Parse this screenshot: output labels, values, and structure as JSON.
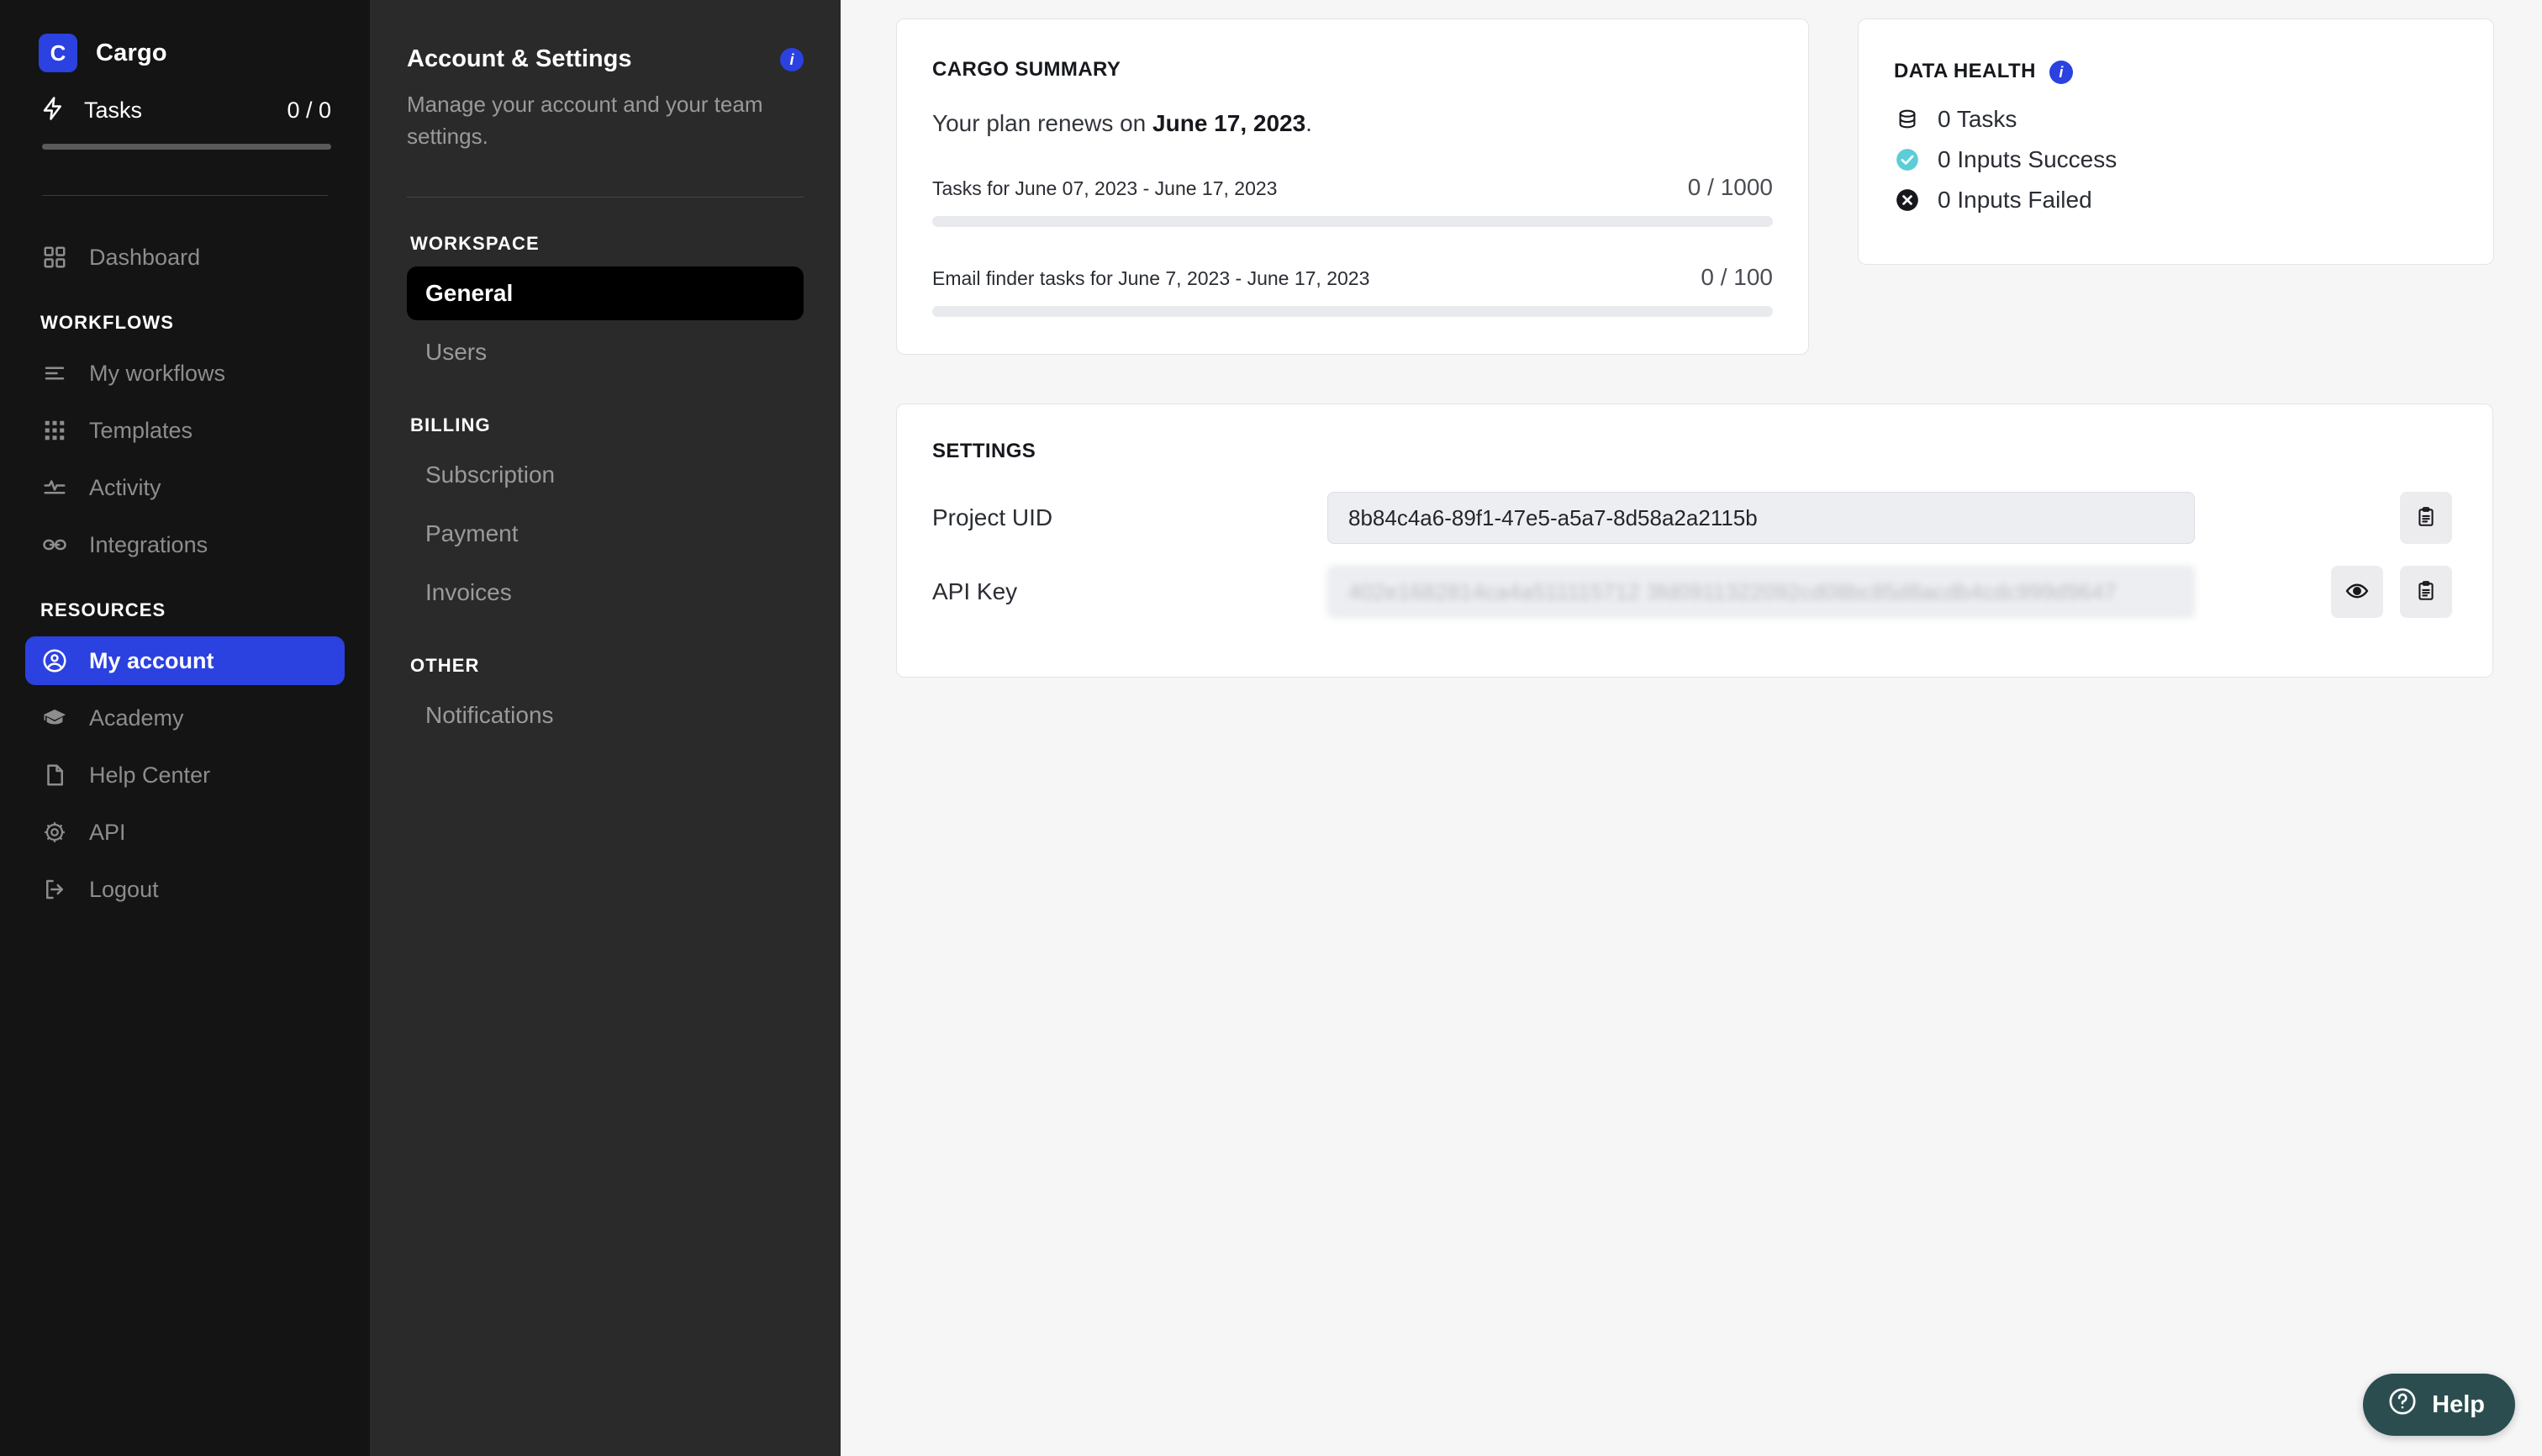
{
  "sidebar": {
    "brand": {
      "logo_letter": "C",
      "name": "Cargo"
    },
    "tasks": {
      "label": "Tasks",
      "count": "0 / 0"
    },
    "top_items": [
      {
        "label": "Dashboard",
        "icon": "grid-icon",
        "active": false
      }
    ],
    "sections": [
      {
        "title": "WORKFLOWS",
        "items": [
          {
            "label": "My workflows",
            "icon": "list-icon",
            "active": false
          },
          {
            "label": "Templates",
            "icon": "dots-grid-icon",
            "active": false
          },
          {
            "label": "Activity",
            "icon": "activity-pulse-icon",
            "active": false
          },
          {
            "label": "Integrations",
            "icon": "link-icon",
            "active": false
          }
        ]
      },
      {
        "title": "RESOURCES",
        "items": [
          {
            "label": "My account",
            "icon": "user-circle-icon",
            "active": true
          },
          {
            "label": "Academy",
            "icon": "graduation-cap-icon",
            "active": false
          },
          {
            "label": "Help Center",
            "icon": "document-icon",
            "active": false
          },
          {
            "label": "API",
            "icon": "gear-icon",
            "active": false
          },
          {
            "label": "Logout",
            "icon": "logout-icon",
            "active": false
          }
        ]
      }
    ]
  },
  "settings_nav": {
    "title": "Account & Settings",
    "info_badge": "i",
    "subtitle": "Manage your account and your team settings.",
    "groups": [
      {
        "title": "WORKSPACE",
        "items": [
          {
            "label": "General",
            "active": true
          },
          {
            "label": "Users",
            "active": false
          }
        ]
      },
      {
        "title": "BILLING",
        "items": [
          {
            "label": "Subscription",
            "active": false
          },
          {
            "label": "Payment",
            "active": false
          },
          {
            "label": "Invoices",
            "active": false
          }
        ]
      },
      {
        "title": "OTHER",
        "items": [
          {
            "label": "Notifications",
            "active": false
          }
        ]
      }
    ]
  },
  "summary_card": {
    "title": "CARGO SUMMARY",
    "renew_prefix": "Your plan renews on ",
    "renew_date": "June 17, 2023",
    "renew_suffix": ".",
    "quotas": [
      {
        "name": "Tasks for June 07, 2023 - June 17, 2023",
        "value": "0 / 1000",
        "percent": 0
      },
      {
        "name": "Email finder tasks for June 7, 2023 - June 17, 2023",
        "value": "0 / 100",
        "percent": 0
      }
    ]
  },
  "health_card": {
    "title": "DATA HEALTH",
    "info_badge": "i",
    "rows": [
      {
        "label": "0 Tasks",
        "icon": "database-icon"
      },
      {
        "label": "0 Inputs Success",
        "icon": "check-circle-icon"
      },
      {
        "label": "0 Inputs Failed",
        "icon": "x-circle-icon"
      }
    ]
  },
  "settings_card": {
    "title": "SETTINGS",
    "project_uid": {
      "label": "Project UID",
      "value": "8b84c4a6-89f1-47e5-a5a7-8d58a2a2115b"
    },
    "api_key": {
      "label": "API Key",
      "value": "402e1682814ca4a511115712 3fd0911322092cd08bc85d8acdb4cdc999d9647"
    }
  },
  "help": {
    "label": "Help"
  },
  "colors": {
    "brand_blue": "#2b41e0",
    "rail_bg": "#141414",
    "settings_bg": "#2a2a2a",
    "main_bg": "#f6f6f7",
    "success_teal": "#5bcdd6",
    "fail_dark": "#16181d",
    "help_teal": "#2b4d4f"
  }
}
